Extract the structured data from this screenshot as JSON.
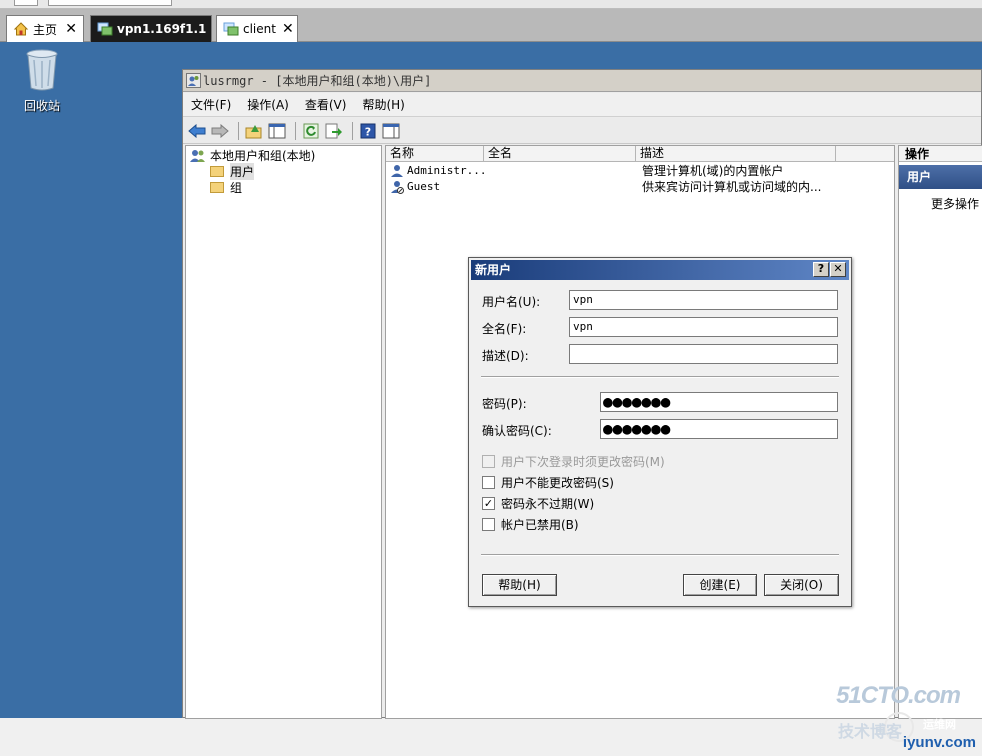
{
  "browser": {
    "tabs": [
      {
        "label": "主页"
      },
      {
        "label": "vpn1.169f1.1"
      },
      {
        "label": "client"
      }
    ],
    "close_glyph": "✕"
  },
  "desktop": {
    "recycle_bin_label": "回收站",
    "background_color": "#3a6ea5"
  },
  "mmc": {
    "title": "lusrmgr - [本地用户和组(本地)\\用户]",
    "menu": [
      "文件(F)",
      "操作(A)",
      "查看(V)",
      "帮助(H)"
    ],
    "toolbar_icons": [
      "back-arrow-icon",
      "forward-arrow-icon",
      "up-folder-icon",
      "show-hide-tree-icon",
      "refresh-icon",
      "export-list-icon",
      "help-icon",
      "show-hide-action-pane-icon"
    ],
    "tree": {
      "root": "本地用户和组(本地)",
      "children": [
        "用户",
        "组"
      ]
    },
    "list": {
      "columns": [
        "名称",
        "全名",
        "描述"
      ],
      "rows": [
        {
          "name": "Administr...",
          "fullname": "",
          "desc": "管理计算机(域)的内置帐户"
        },
        {
          "name": "Guest",
          "fullname": "",
          "desc": "供来宾访问计算机或访问域的内..."
        }
      ]
    },
    "actions": {
      "header": "操作",
      "section": "用户",
      "more": "更多操作"
    }
  },
  "dialog": {
    "title": "新用户",
    "help_glyph": "?",
    "close_glyph": "✕",
    "username_label": "用户名(U):",
    "username_value": "vpn",
    "fullname_label": "全名(F):",
    "fullname_value": "vpn",
    "desc_label": "描述(D):",
    "desc_value": "",
    "password_label": "密码(P):",
    "password_value": "●●●●●●●",
    "confirm_label": "确认密码(C):",
    "confirm_value": "●●●●●●●",
    "checkboxes": [
      {
        "label": "用户下次登录时须更改密码(M)",
        "checked": false,
        "disabled": true
      },
      {
        "label": "用户不能更改密码(S)",
        "checked": false,
        "disabled": false
      },
      {
        "label": "密码永不过期(W)",
        "checked": true,
        "disabled": false
      },
      {
        "label": "帐户已禁用(B)",
        "checked": false,
        "disabled": false
      }
    ],
    "check_glyph": "✓",
    "help_button": "帮助(H)",
    "create_button": "创建(E)",
    "close_button": "关闭(O)"
  },
  "watermark": {
    "line1": "51CTO.com",
    "line2": "技术博客",
    "line3": "运维网",
    "line4": "iyunv.com"
  }
}
